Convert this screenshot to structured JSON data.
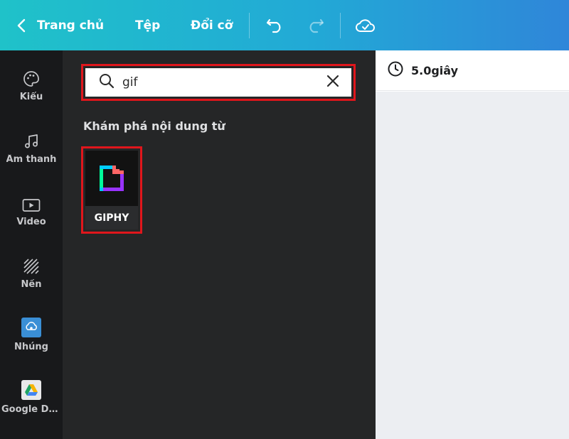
{
  "topbar": {
    "home_label": "Trang chủ",
    "file_label": "Tệp",
    "resize_label": "Đổi cỡ",
    "icons": [
      "chevron-left-icon",
      "undo-icon",
      "redo-icon",
      "cloud-check-icon"
    ]
  },
  "rail": {
    "items": [
      {
        "label": "Kiểu",
        "icon": "palette-icon"
      },
      {
        "label": "Âm thanh",
        "icon": "music-note-icon"
      },
      {
        "label": "Video",
        "icon": "video-icon"
      },
      {
        "label": "Nền",
        "icon": "background-pattern-icon"
      },
      {
        "label": "Nhúng",
        "icon": "embed-icon"
      },
      {
        "label": "Google Dri...",
        "icon": "google-drive-icon"
      }
    ]
  },
  "search": {
    "value": "gif",
    "placeholder": ""
  },
  "panel": {
    "section_title": "Khám phá nội dung từ",
    "apps": [
      {
        "label": "GIPHY",
        "icon": "giphy-logo-icon"
      }
    ]
  },
  "timer": {
    "duration": "5.0giây"
  },
  "colors": {
    "topbar_start": "#1fc2c9",
    "topbar_end": "#2f86d9",
    "highlight": "#e0161c",
    "rail_bg": "#18191b",
    "panel_bg": "#252627",
    "canvas_bg": "#eceef2"
  }
}
